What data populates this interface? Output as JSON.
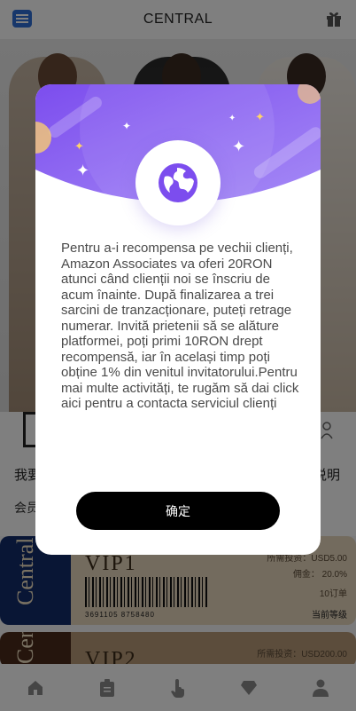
{
  "header": {
    "title": "CENTRAL",
    "menu_icon": "menu-icon",
    "gift_icon": "gift-icon"
  },
  "functions": {
    "left_label": "我要",
    "right_label": "说明",
    "sub_label": "会员"
  },
  "vip_cards": [
    {
      "brand": "Central",
      "name": "VIP1",
      "invest": "所需投资：USD5.00",
      "commission": "佣金：  20.0%",
      "orders": "10订单",
      "level": "当前等级",
      "barcode_text": "3691105  8758480"
    },
    {
      "brand": "Central",
      "name": "VIP2",
      "invest": "所需投资：USD200.00"
    }
  ],
  "tabbar": {
    "icons": [
      "home-icon",
      "clipboard-icon",
      "tap-hand-icon",
      "diamond-icon",
      "user-icon"
    ]
  },
  "modal": {
    "message": "Pentru a-i recompensa pe vechii clienți, Amazon Associates va oferi 20RON atunci când clienții noi se înscriu de acum înainte. După finalizarea a trei sarcini de tranzacționare, puteți retrage numerar. Invită prietenii să se alăture platformei, poți primi 10RON drept recompensă, iar în același timp poți obține 1% din venitul invitatorului.Pentru mai multe activități, te rugăm să dai click aici pentru a contacta serviciul clienți",
    "confirm_label": "确定",
    "globe_icon": "globe-icon",
    "colors": {
      "accent": "#8b5cf6",
      "hero_light": "#a98bf5",
      "button": "#000000"
    }
  }
}
